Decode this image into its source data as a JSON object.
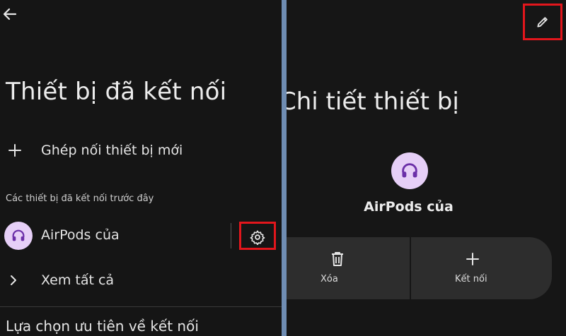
{
  "left": {
    "title": "Thiết bị đã kết nối",
    "pair_new_label": "Ghép nối thiết bị mới",
    "section_label": "Các thiết bị đã kết nối trước đây",
    "device_name": "AirPods của",
    "see_all_label": "Xem tất cả",
    "preferences_label": "Lựa chọn ưu tiên về kết nối"
  },
  "right": {
    "title": "Chi tiết thiết bị",
    "device_name": "AirPods của",
    "delete_label": "Xóa",
    "connect_label": "Kết nối"
  },
  "icons": {
    "back": "arrow-left-icon",
    "add": "plus-icon",
    "device": "headphones-icon",
    "settings": "gear-icon",
    "expand": "chevron-right-icon",
    "edit": "pencil-icon",
    "delete": "trash-icon"
  },
  "colors": {
    "background": "#151515",
    "avatar": "#e6cff7",
    "avatar_glyph": "#6b2fa8",
    "highlight": "#e2161c",
    "action_bar": "#2d2d2d"
  }
}
